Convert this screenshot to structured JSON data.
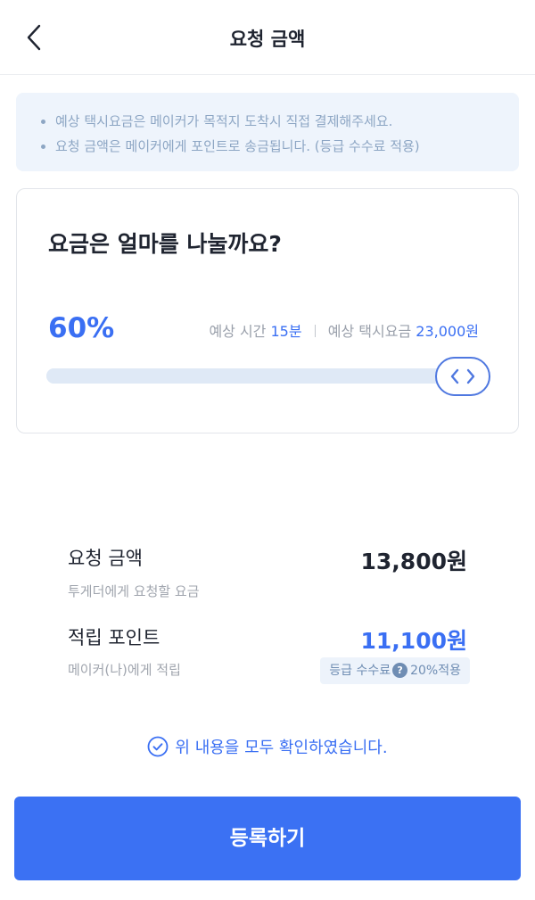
{
  "header": {
    "title": "요청 금액",
    "back_icon": "chevron-left-icon"
  },
  "notice": {
    "items": [
      "예상 택시요금은 메이커가 목적지 도착시 직접 결제해주세요.",
      "요청 금액은 메이커에게 포인트로 송금됩니다. (등급 수수료 적용)"
    ]
  },
  "card": {
    "question": "요금은 얼마를 나눌까요?",
    "percent": "60%",
    "share_fraction": 0.6,
    "estimate": {
      "time_label": "예상 시간",
      "time_value": "15분",
      "fare_label": "예상 택시요금",
      "fare_value": "23,000원"
    },
    "slider_handle_icon": "chevron-left-right-icon"
  },
  "summary": {
    "request_label": "요청 금액",
    "request_sub": "투게더에게 요청할 요금",
    "request_value": "13,800원",
    "points_label": "적립 포인트",
    "points_sub": "메이커(나)에게 적립",
    "points_value": "11,100원",
    "fee_label": "등급 수수료",
    "fee_help_icon": "question-circle-icon",
    "fee_value": "20%적용"
  },
  "confirm": {
    "text": "위 내용을 모두 확인하였습니다.",
    "icon": "check-circle-icon"
  },
  "submit": {
    "label": "등록하기"
  },
  "colors": {
    "accent": "#3b71f3",
    "text": "#1f2430",
    "notice_bg": "#eef4fc",
    "slider_track": "#dfe9f6"
  }
}
